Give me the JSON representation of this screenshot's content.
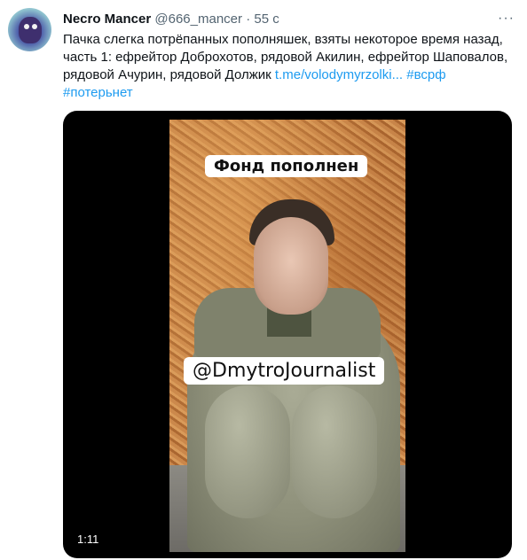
{
  "tweet": {
    "author_name": "Necro Mancer",
    "handle": "@666_mancer",
    "separator": "·",
    "time": "55 с",
    "more_label": "···",
    "text_main": "Пачка слегка потрёпанных пополняшек, взяты некоторое время назад, часть 1: ефрейтор Доброхотов, рядовой Акилин, ефрейтор Шаповалов, рядовой Ачурин, рядовой Должик ",
    "link_url": "t.me/volodymyrzolki...",
    "hashtag_1": "#всрф",
    "hashtag_2": "#потерьнет"
  },
  "media": {
    "caption_top": "Фонд пополнен",
    "caption_bottom": "@DmytroJournalist",
    "duration": "1:11"
  },
  "colors": {
    "link": "#1d9bf0",
    "secondary_text": "#536471",
    "media_bg": "#000000"
  }
}
